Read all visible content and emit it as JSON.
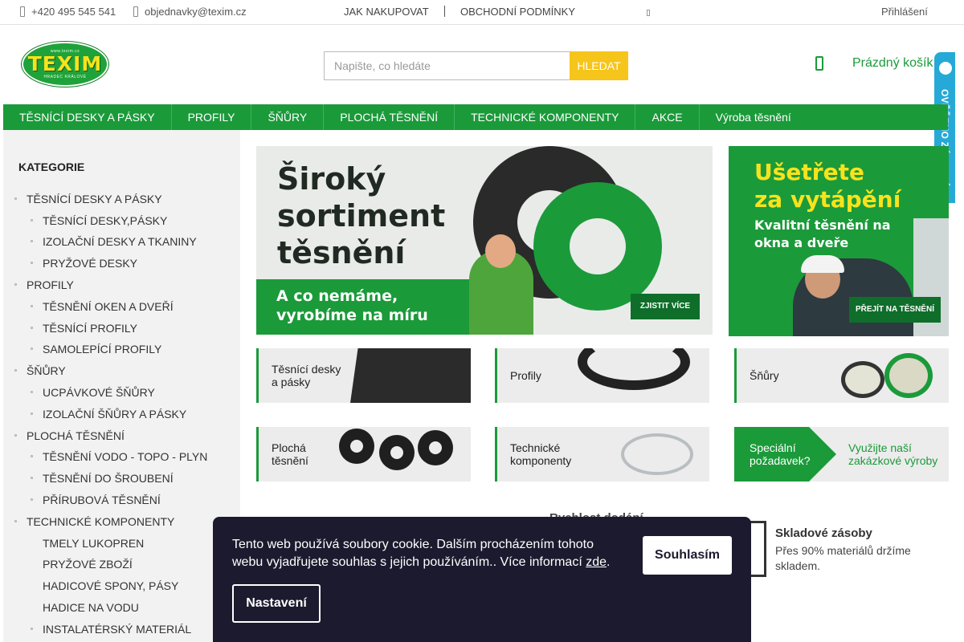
{
  "topbar": {
    "phone": "+420 495 545 541",
    "email": "objednavky@texim.cz",
    "links": [
      "JAK NAKUPOVAT",
      "OBCHODNÍ PODMÍNKY"
    ],
    "login": "Přihlášení"
  },
  "logo": {
    "small_top": "www.texim.cz",
    "brand": "TEXIM",
    "small_bottom": "HRADEC KRÁLOVÉ"
  },
  "search": {
    "placeholder": "Napište, co hledáte",
    "button": "HLEDAT"
  },
  "cart": {
    "label": "Prázdný košík"
  },
  "badge": {
    "text": "OVĚŘENO ZÁKAZNÍKY"
  },
  "nav": [
    "TĚSNÍCÍ DESKY A PÁSKY",
    "PROFILY",
    "ŠŇŮRY",
    "PLOCHÁ TĚSNĚNÍ",
    "TECHNICKÉ KOMPONENTY",
    "AKCE",
    "Výroba těsnění"
  ],
  "sidebar": {
    "title": "KATEGORIE",
    "items": [
      "TĚSNÍCÍ DESKY A PÁSKY",
      "TĚSNÍCÍ DESKY,PÁSKY",
      "IZOLAČNÍ DESKY A TKANINY",
      "PRYŽOVÉ DESKY",
      "PROFILY",
      "TĚSNĚNÍ OKEN A DVEŘÍ",
      "TĚSNÍCÍ PROFILY",
      "SAMOLEPÍCÍ PROFILY",
      "ŠŇŮRY",
      "UCPÁVKOVÉ ŠŇŮRY",
      "IZOLAČNÍ ŠŇŮRY A PÁSKY",
      "PLOCHÁ TĚSNĚNÍ",
      "TĚSNĚNÍ VODO - TOPO - PLYN",
      "TĚSNĚNÍ DO ŠROUBENÍ",
      "PŘÍRUBOVÁ TĚSNĚNÍ",
      "TECHNICKÉ KOMPONENTY",
      "TMELY LUKOPREN",
      "PRYŽOVÉ ZBOŽÍ",
      "HADICOVÉ SPONY, PÁSY",
      "HADICE NA VODU",
      "INSTALATÉRSKÝ MATERIÁL"
    ]
  },
  "banner_main": {
    "headline_1": "Široký",
    "headline_2": "sortiment",
    "headline_3": "těsnění",
    "strip_1": "A co nemáme,",
    "strip_2": "vyrobíme na míru",
    "cta": "ZJISTIT VÍCE"
  },
  "banner_side": {
    "headline_1": "Ušetřete",
    "headline_2": "za vytápění",
    "sub_1": "Kvalitní těsnění na",
    "sub_2": "okna a dveře",
    "cta": "PŘEJÍT NA TĚSNĚNÍ"
  },
  "tiles": {
    "desky_1": "Těsnící desky",
    "desky_2": "a pásky",
    "profily": "Profily",
    "snury": "Šňůry",
    "plocha_1": "Plochá",
    "plocha_2": "těsnění",
    "tech_1": "Technické",
    "tech_2": "komponenty",
    "special_1": "Speciální",
    "special_2": "požadavek?",
    "special_3": "Využijte naší",
    "special_4": "zakázkové výroby"
  },
  "info": {
    "title": "Rychlost dodání",
    "stock_title": "Skladové zásoby",
    "stock_text": "Přes 90% materiálů držíme skladem."
  },
  "cookie": {
    "text": "Tento web používá soubory cookie. Dalším procházením tohoto webu vyjadřujete souhlas s jejich používáním.. Více informací ",
    "link": "zde",
    "after": ".",
    "accept": "Souhlasím",
    "settings": "Nastavení"
  },
  "colors": {
    "brand_green": "#1b9a3a",
    "accent_yellow": "#f6c51b",
    "cookie_bg": "#1c1a2e",
    "badge_blue": "#26a9d6"
  }
}
